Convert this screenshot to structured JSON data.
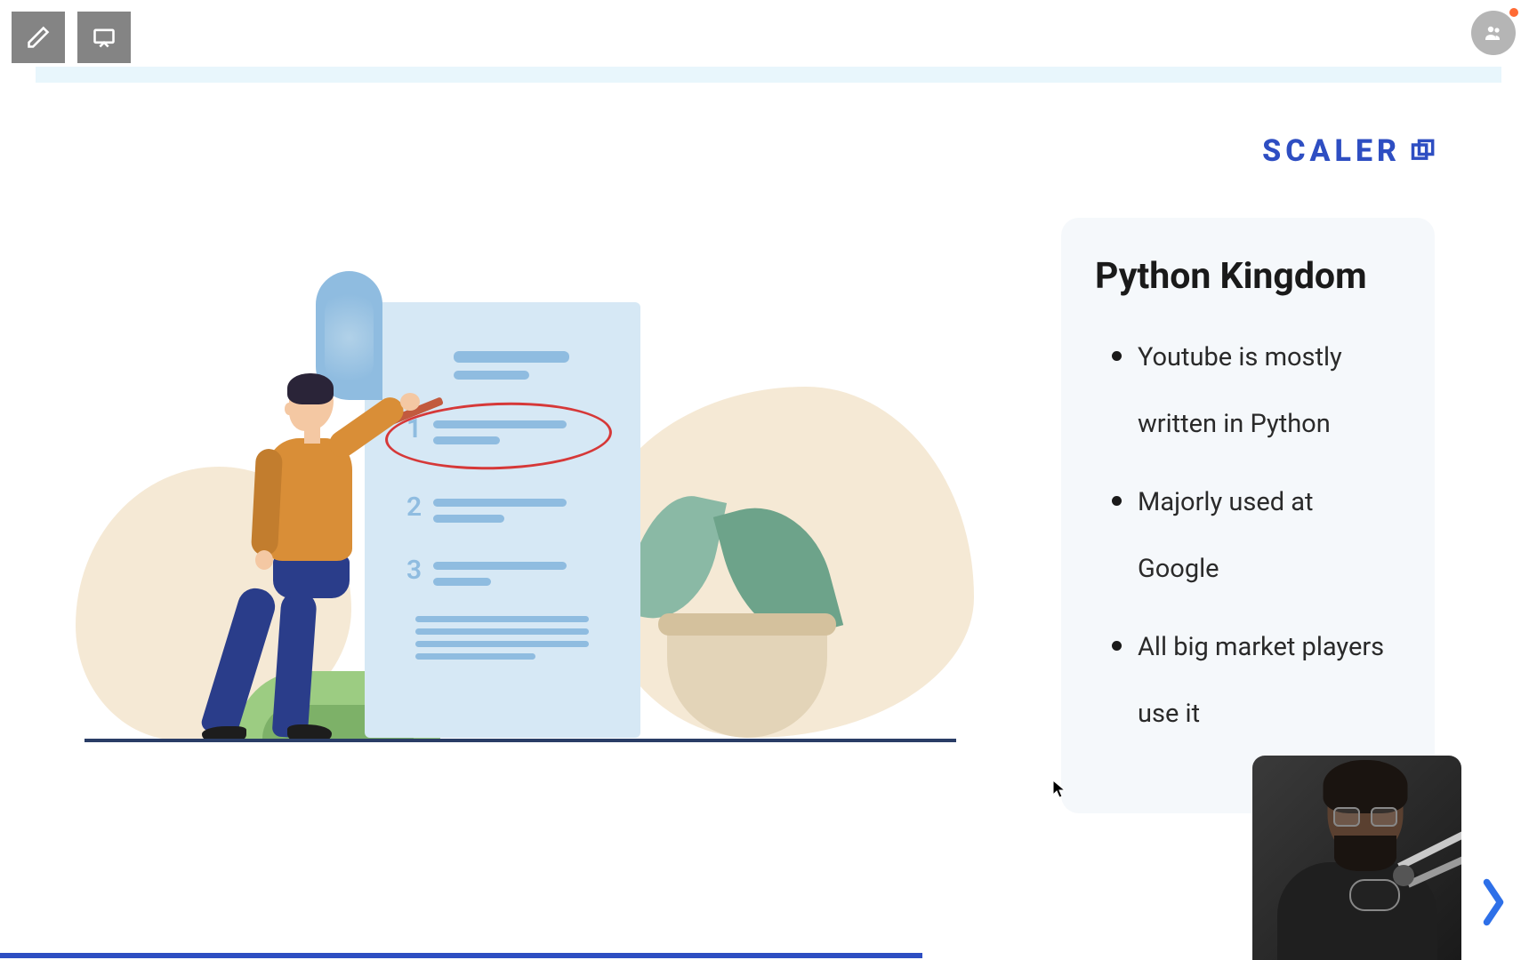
{
  "toolbar": {
    "pencil_label": "pencil",
    "present_label": "present"
  },
  "brand": {
    "text": "SCALER"
  },
  "card": {
    "title": "Python Kingdom",
    "bullets": [
      "Youtube is mostly written in Python",
      "Majorly used at Google",
      "All big market players use it"
    ]
  },
  "illustration": {
    "list_numbers": [
      "1",
      "2",
      "3"
    ]
  },
  "colors": {
    "brand_blue": "#2e4ec2",
    "annotation_red": "#d63838"
  }
}
